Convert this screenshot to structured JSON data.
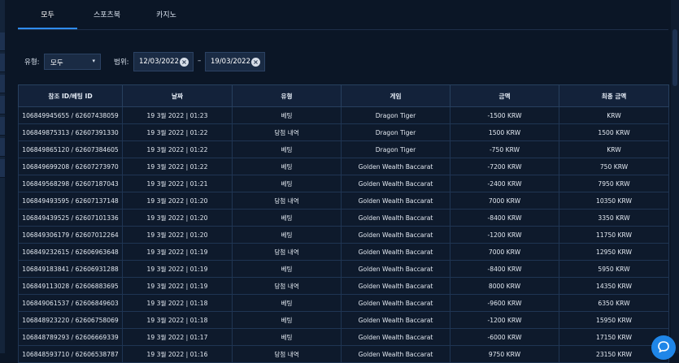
{
  "tabs": [
    {
      "label": "모두",
      "active": true
    },
    {
      "label": "스포츠북",
      "active": false
    },
    {
      "label": "카지노",
      "active": false
    }
  ],
  "filters": {
    "type_label": "유형:",
    "type_value": "모두",
    "range_label": "범위:",
    "date_from": "12/03/2022",
    "date_to": "19/03/2022",
    "range_separator": "–"
  },
  "table": {
    "columns": [
      "참조 ID/베팅 ID",
      "날짜",
      "유형",
      "게임",
      "금액",
      "최종 금액"
    ],
    "rows": [
      [
        "106849945655 / 62607438059",
        "19 3월 2022 | 01:23",
        "베팅",
        "Dragon Tiger",
        "-1500 KRW",
        "KRW"
      ],
      [
        "106849875313 / 62607391330",
        "19 3월 2022 | 01:22",
        "당첨 내역",
        "Dragon Tiger",
        "1500 KRW",
        "1500 KRW"
      ],
      [
        "106849865120 / 62607384605",
        "19 3월 2022 | 01:22",
        "베팅",
        "Dragon Tiger",
        "-750 KRW",
        "KRW"
      ],
      [
        "106849699208 / 62607273970",
        "19 3월 2022 | 01:22",
        "베팅",
        "Golden Wealth Baccarat",
        "-7200 KRW",
        "750 KRW"
      ],
      [
        "106849568298 / 62607187043",
        "19 3월 2022 | 01:21",
        "베팅",
        "Golden Wealth Baccarat",
        "-2400 KRW",
        "7950 KRW"
      ],
      [
        "106849493595 / 62607137148",
        "19 3월 2022 | 01:20",
        "당첨 내역",
        "Golden Wealth Baccarat",
        "7000 KRW",
        "10350 KRW"
      ],
      [
        "106849439525 / 62607101336",
        "19 3월 2022 | 01:20",
        "베팅",
        "Golden Wealth Baccarat",
        "-8400 KRW",
        "3350 KRW"
      ],
      [
        "106849306179 / 62607012264",
        "19 3월 2022 | 01:20",
        "베팅",
        "Golden Wealth Baccarat",
        "-1200 KRW",
        "11750 KRW"
      ],
      [
        "106849232615 / 62606963648",
        "19 3월 2022 | 01:19",
        "당첨 내역",
        "Golden Wealth Baccarat",
        "7000 KRW",
        "12950 KRW"
      ],
      [
        "106849183841 / 62606931288",
        "19 3월 2022 | 01:19",
        "베팅",
        "Golden Wealth Baccarat",
        "-8400 KRW",
        "5950 KRW"
      ],
      [
        "106849113028 / 62606883695",
        "19 3월 2022 | 01:19",
        "당첨 내역",
        "Golden Wealth Baccarat",
        "8000 KRW",
        "14350 KRW"
      ],
      [
        "106849061537 / 62606849603",
        "19 3월 2022 | 01:18",
        "베팅",
        "Golden Wealth Baccarat",
        "-9600 KRW",
        "6350 KRW"
      ],
      [
        "106848923220 / 62606758069",
        "19 3월 2022 | 01:18",
        "베팅",
        "Golden Wealth Baccarat",
        "-1200 KRW",
        "15950 KRW"
      ],
      [
        "106848789293 / 62606669339",
        "19 3월 2022 | 01:17",
        "베팅",
        "Golden Wealth Baccarat",
        "-6000 KRW",
        "17150 KRW"
      ],
      [
        "106848593710 / 62606538787",
        "19 3월 2022 | 01:16",
        "당첨 내역",
        "Golden Wealth Baccarat",
        "9750 KRW",
        "23150 KRW"
      ]
    ]
  },
  "icons": {
    "clear": "clear-icon",
    "caret": "chevron-down-icon",
    "chat": "chat-icon"
  },
  "colors": {
    "background": "#0b1626",
    "accent": "#2f8cf0",
    "header": "#13223a",
    "chat": "#1f86e8"
  }
}
